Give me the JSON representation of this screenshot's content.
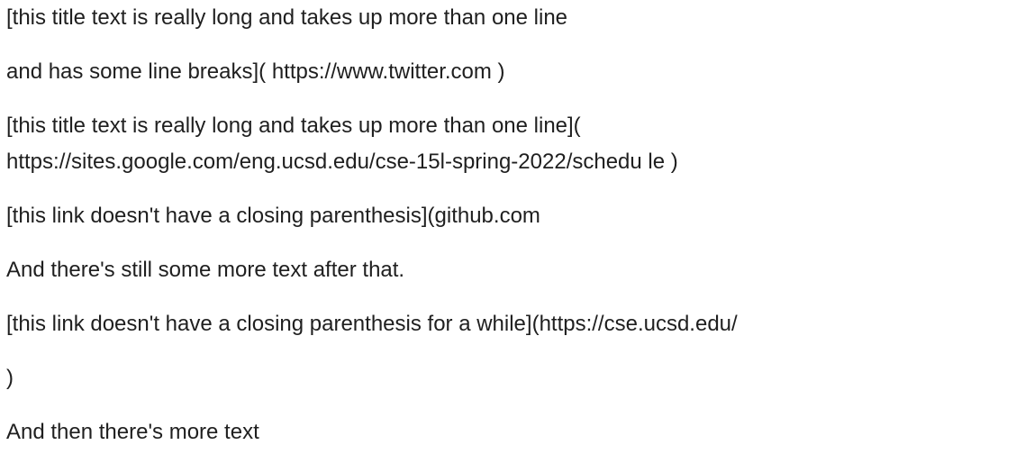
{
  "document": {
    "paragraphs": [
      "[this title text is really long and takes up more than one line",
      "and has some line breaks]( https://www.twitter.com )",
      {
        "line1": "[this title text is really long and takes up more than one line](",
        "line2": "https://sites.google.com/eng.ucsd.edu/cse-15l-spring-2022/schedu le )"
      },
      "[this link doesn't have a closing parenthesis](github.com",
      "And there's still some more text after that.",
      "[this link doesn't have a closing parenthesis for a while](https://cse.ucsd.edu/",
      ")",
      "And then there's more text"
    ]
  }
}
